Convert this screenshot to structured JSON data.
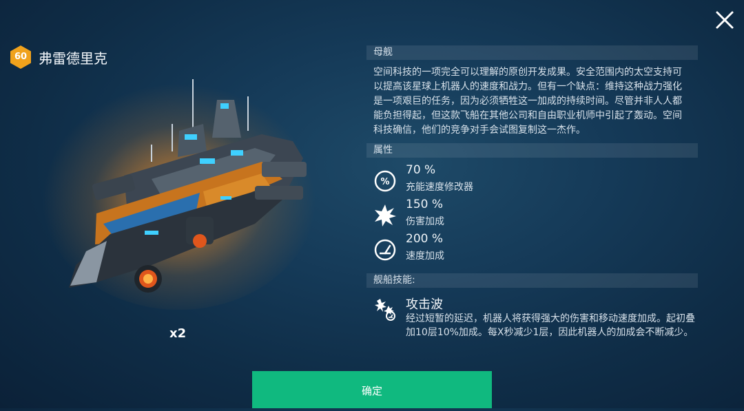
{
  "ship": {
    "level": "60",
    "name": "弗雷德里克",
    "count": "x2"
  },
  "sections": {
    "mothership": "母舰",
    "attributes": "属性",
    "skill": "舰船技能:"
  },
  "description": "空间科技的一项完全可以理解的原创开发成果。安全范围内的太空支持可以提高该星球上机器人的速度和战力。但有一个缺点：维持这种战力强化是一项艰巨的任务，因为必须牺牲这一加成的持续时间。尽管并非人人都能负担得起，但这款飞船在其他公司和自由职业机师中引起了轰动。空间科技确信，他们的竞争对手会试图复制这一杰作。",
  "attributes": [
    {
      "value": "70 %",
      "label": "充能速度修改器",
      "icon": "percent-icon"
    },
    {
      "value": "150 %",
      "label": "伤害加成",
      "icon": "burst-icon"
    },
    {
      "value": "200 %",
      "label": "速度加成",
      "icon": "speedometer-icon"
    }
  ],
  "skill": {
    "name": "攻击波",
    "description": "经过短暂的延迟，机器人将获得强大的伤害和移动速度加成。起初叠加10层10%加成。每X秒减少1层，因此机器人的加成会不断减少。",
    "icon": "attack-wave-icon"
  },
  "buttons": {
    "confirm": "确定",
    "close": "close-icon"
  },
  "colors": {
    "confirm_button": "#10b97f",
    "level_badge": "#f0a21c",
    "background": "#153a58"
  }
}
